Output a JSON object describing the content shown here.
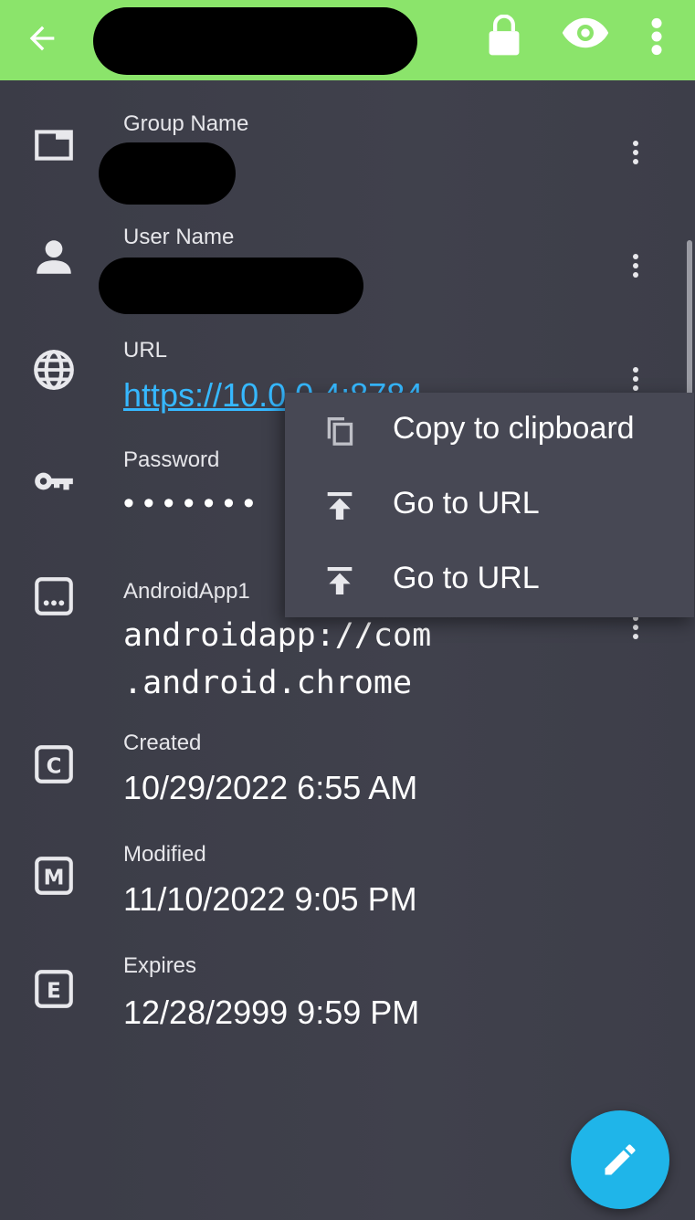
{
  "fields": {
    "group_name": {
      "label": "Group Name"
    },
    "user_name": {
      "label": "User Name"
    },
    "url": {
      "label": "URL",
      "value": "https://10.0.0.4:8784"
    },
    "password": {
      "label": "Password",
      "value": "•••••••"
    },
    "android_app": {
      "label": "AndroidApp1",
      "value": "androidapp://com\n.android.chrome"
    },
    "created": {
      "label": "Created",
      "value": "10/29/2022 6:55 AM"
    },
    "modified": {
      "label": "Modified",
      "value": "11/10/2022 9:05 PM"
    },
    "expires": {
      "label": "Expires",
      "value": "12/28/2999 9:59 PM"
    }
  },
  "context_menu": {
    "items": [
      {
        "label": "Copy to clipboard",
        "icon": "copy-icon"
      },
      {
        "label": "Go to URL",
        "icon": "upload-arrow-icon"
      },
      {
        "label": "Go to URL",
        "icon": "upload-arrow-icon"
      }
    ]
  },
  "icons": {
    "group": "folder-icon",
    "user": "person-icon",
    "url": "globe-icon",
    "password": "key-icon",
    "android_app": "app-window-icon",
    "created": "created-c-icon",
    "modified": "modified-m-icon",
    "expires": "expires-e-icon",
    "fab": "pencil-icon"
  },
  "colors": {
    "appbar": "#8be46b",
    "background": "#3c3d48",
    "link": "#36b8ff",
    "fab": "#1fb5e9",
    "menu": "#474854"
  }
}
